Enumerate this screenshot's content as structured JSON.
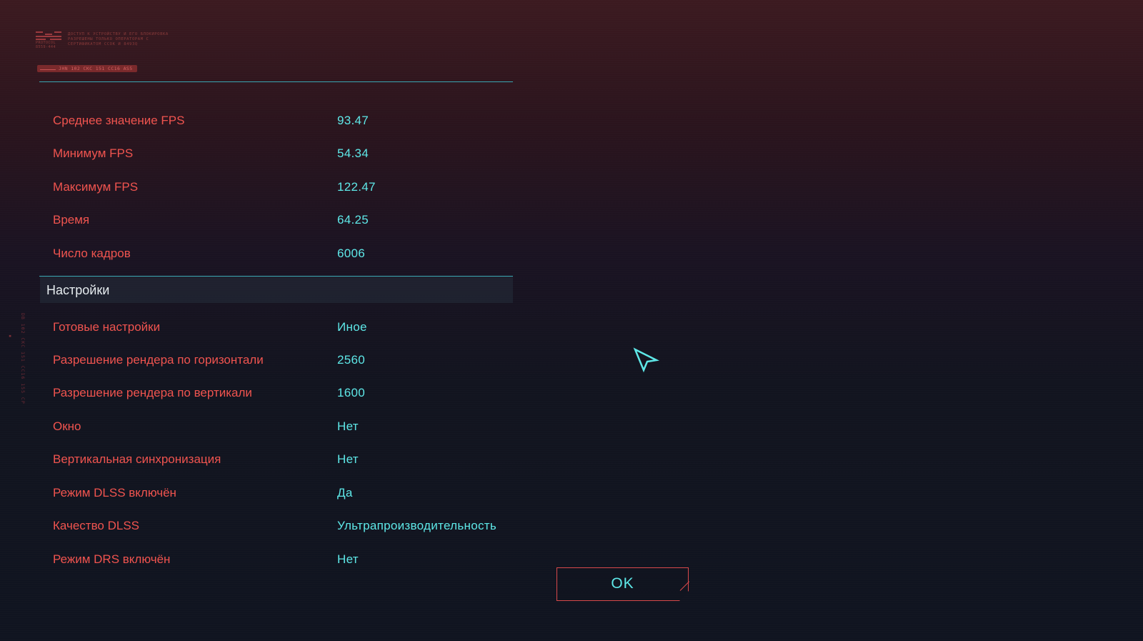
{
  "header": {
    "logo_caption": "PROTOCOL 8559-444",
    "notice": "ДОСТУП К УСТРОЙСТВУ И ЕГО БЛОКИРОВКА РАЗРЕШЕНЫ ТОЛЬКО ОПЕРАТОРАМ С СЕРТИФИКАТОМ CCOK И 8493Q",
    "tag": "JHN 102 CKC 151 CC16 AS5"
  },
  "side_label": "DB 102 CKC 151 CC16 155 CP",
  "results": [
    {
      "label": "Среднее значение FPS",
      "value": "93.47"
    },
    {
      "label": "Минимум FPS",
      "value": "54.34"
    },
    {
      "label": "Максимум FPS",
      "value": "122.47"
    },
    {
      "label": "Время",
      "value": "64.25"
    },
    {
      "label": "Число кадров",
      "value": "6006"
    }
  ],
  "settings_section": {
    "title": "Настройки",
    "rows": [
      {
        "label": "Готовые настройки",
        "value": "Иное"
      },
      {
        "label": "Разрешение рендера по горизонтали",
        "value": "2560"
      },
      {
        "label": "Разрешение рендера по вертикали",
        "value": "1600"
      },
      {
        "label": "Окно",
        "value": "Нет"
      },
      {
        "label": "Вертикальная синхронизация",
        "value": "Нет"
      },
      {
        "label": "Режим DLSS включён",
        "value": "Да"
      },
      {
        "label": "Качество DLSS",
        "value": "Ультрапроизводительность"
      },
      {
        "label": "Режим DRS включён",
        "value": "Нет"
      }
    ]
  },
  "ok_button": {
    "label": "OK"
  },
  "colors": {
    "label": "#f0544f",
    "value": "#5ee8e8",
    "accent_line": "#3aa8b3",
    "button_border": "#d9494b"
  },
  "icons": {
    "cursor": "cursor-arrow-icon",
    "logo": "protocol-logo-icon"
  }
}
